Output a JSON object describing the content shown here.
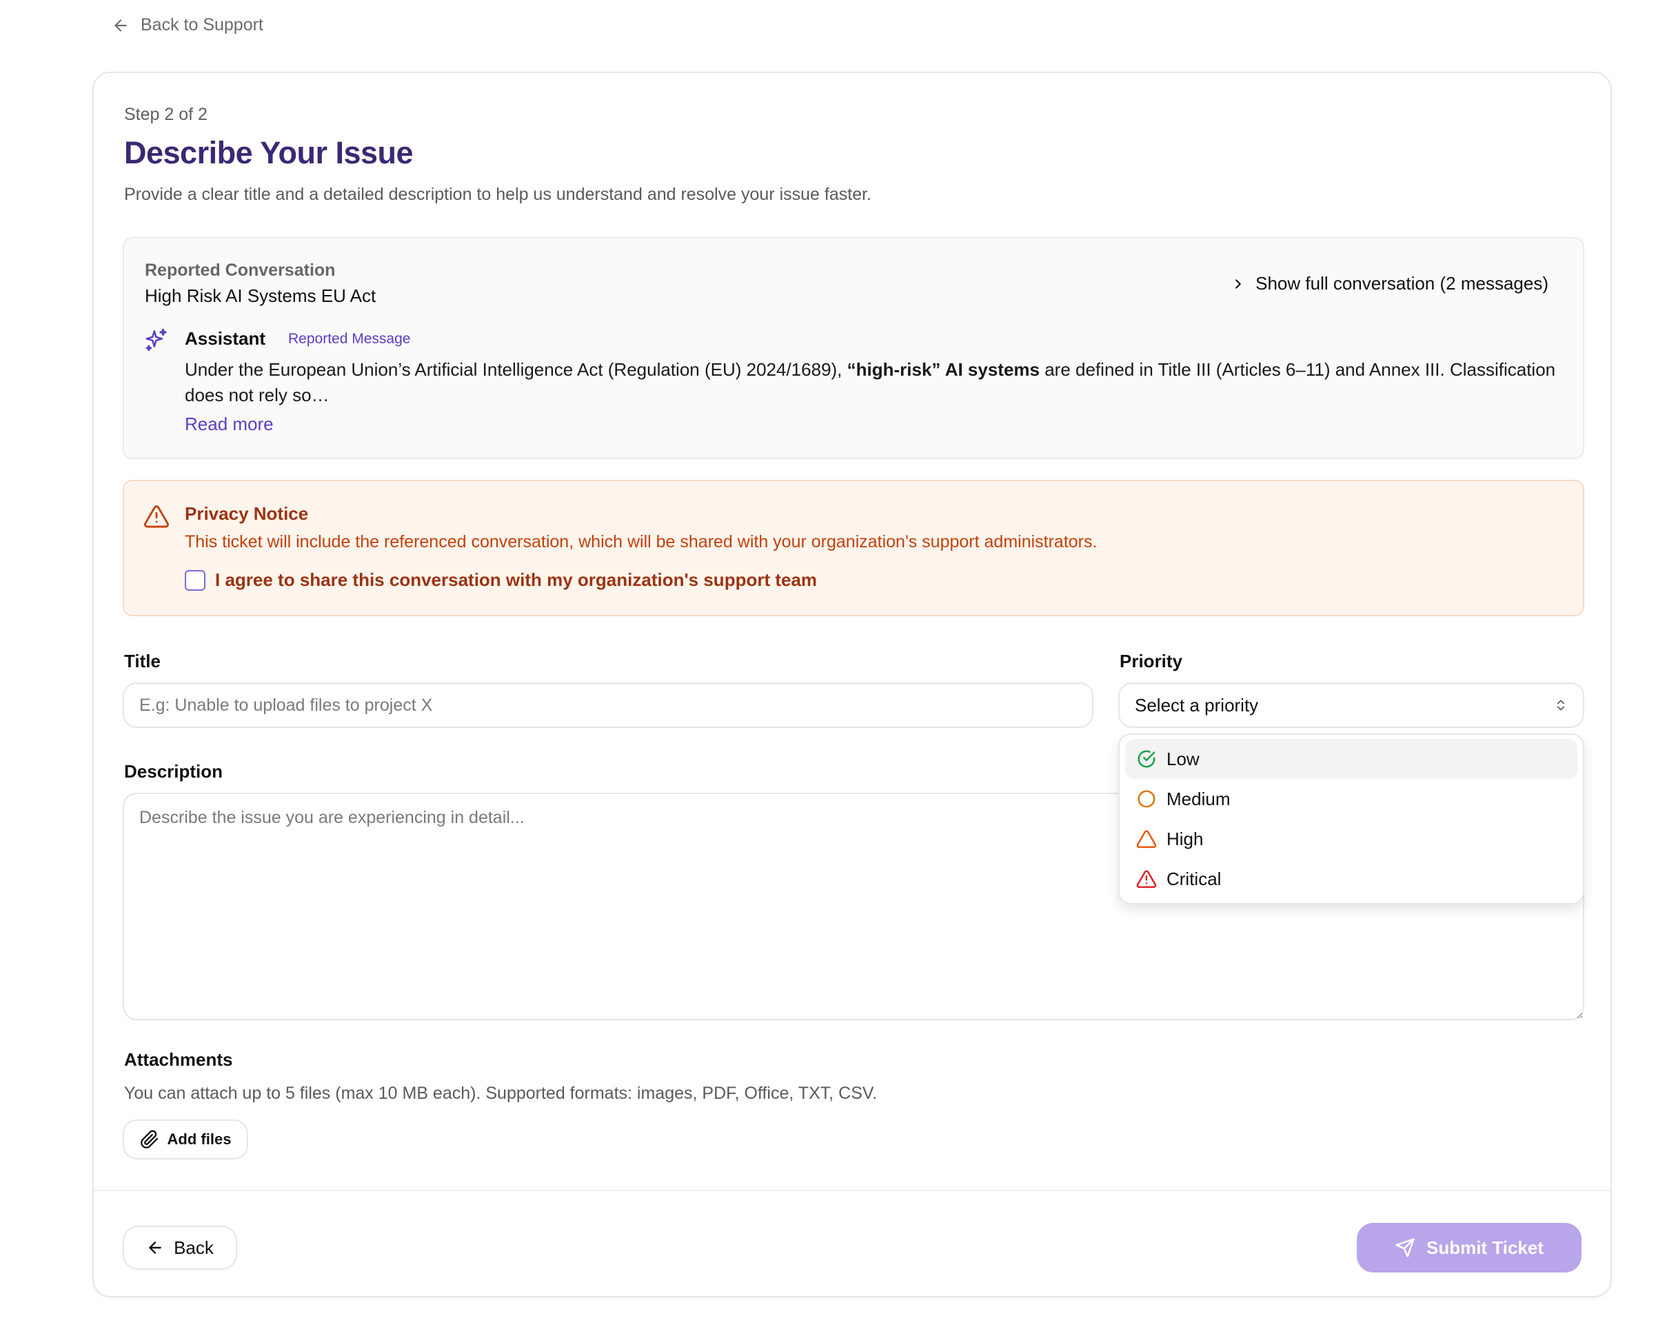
{
  "nav": {
    "back_label": "Back to Support"
  },
  "header": {
    "step": "Step 2 of 2",
    "title": "Describe Your Issue",
    "subtitle": "Provide a clear title and a detailed description to help us understand and resolve your issue faster."
  },
  "conversation": {
    "label": "Reported Conversation",
    "title": "High Risk AI Systems EU Act",
    "show_full": "Show full conversation (2 messages)",
    "message": {
      "role": "Assistant",
      "tag": "Reported Message",
      "text_before": "Under the European Union’s Artificial Intelligence Act (Regulation (EU) 2024/1689), ",
      "text_bold": "“high-risk” AI systems",
      "text_after": " are defined in Title III (Articles 6–11) and Annex III. Classification does not rely so…",
      "read_more": "Read more"
    }
  },
  "privacy": {
    "title": "Privacy Notice",
    "text": "This ticket will include the referenced conversation, which will be shared with your organization's support administrators.",
    "agree_label": "I agree to share this conversation with my organization's support team",
    "agreed": false
  },
  "form": {
    "title_label": "Title",
    "title_placeholder": "E.g: Unable to upload files to project X",
    "title_value": "",
    "priority_label": "Priority",
    "priority_placeholder": "Select a priority",
    "priority_options": [
      {
        "label": "Low",
        "icon": "check-circle-icon",
        "color": "#16a34a"
      },
      {
        "label": "Medium",
        "icon": "circle-icon",
        "color": "#d97706"
      },
      {
        "label": "High",
        "icon": "triangle-icon",
        "color": "#ea580c"
      },
      {
        "label": "Critical",
        "icon": "alert-triangle-icon",
        "color": "#dc2626"
      }
    ],
    "highlighted_option": "Low",
    "description_label": "Description",
    "description_placeholder": "Describe the issue you are experiencing in detail...",
    "description_value": "",
    "attachments_label": "Attachments",
    "attachments_help": "You can attach up to 5 files (max 10 MB each). Supported formats: images, PDF, Office, TXT, CSV.",
    "add_files_label": "Add files"
  },
  "footer": {
    "back_label": "Back",
    "submit_label": "Submit Ticket"
  },
  "colors": {
    "accent": "#5b3fc4",
    "title": "#3b2873",
    "submit_disabled": "#b9a5ea",
    "warning_text": "#c2410c",
    "warning_bg": "#fff5ec"
  }
}
